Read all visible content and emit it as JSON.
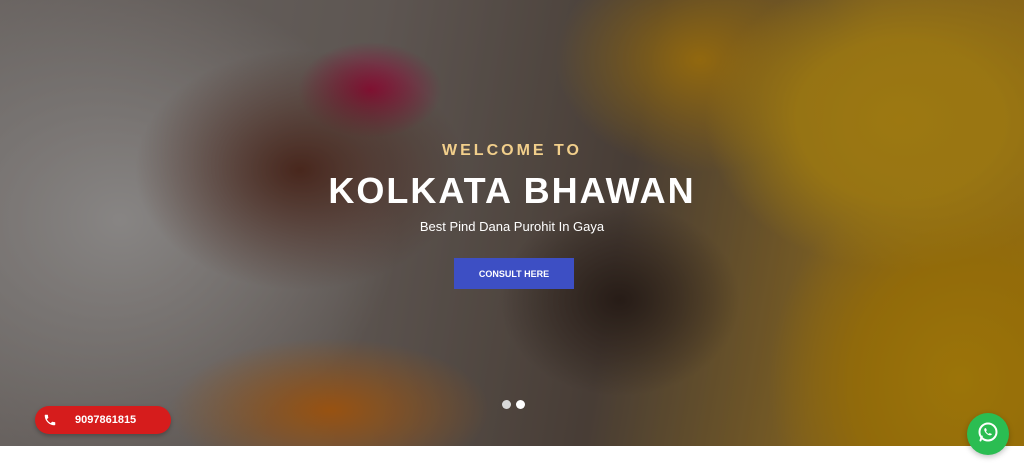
{
  "hero": {
    "welcome": "WELCOME TO",
    "title": "KOLKATA BHAWAN",
    "subtitle": "Best Pind Dana Purohit In Gaya",
    "cta_label": "CONSULT HERE",
    "slides_total": 2,
    "slide_active": 1
  },
  "call": {
    "number": "9097861815",
    "icon": "phone-icon",
    "color": "#d61c1c"
  },
  "whatsapp": {
    "icon": "whatsapp-icon",
    "color": "#2bbd52"
  },
  "colors": {
    "accent": "#3d4fc4",
    "welcome_text": "#f2cf8b"
  }
}
